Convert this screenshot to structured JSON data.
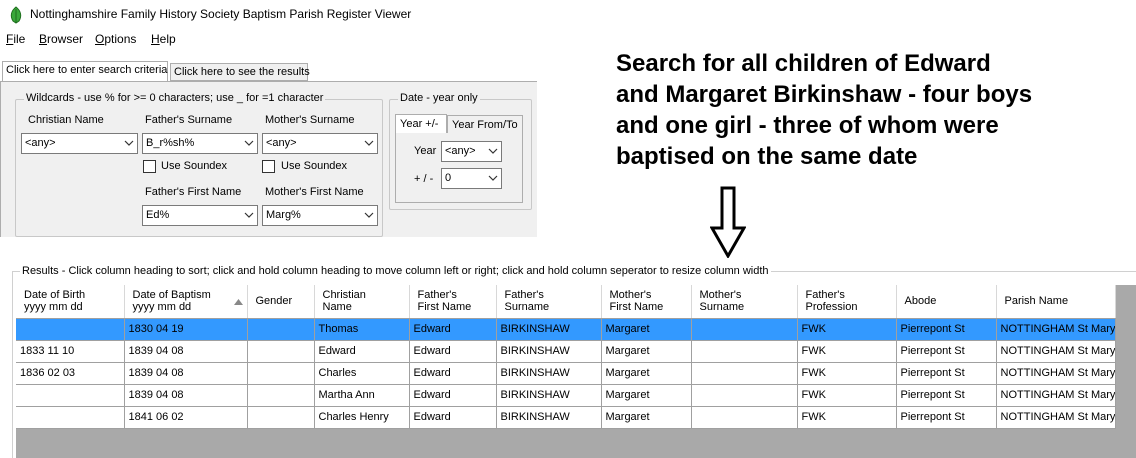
{
  "window": {
    "title": "Nottinghamshire Family History Society Baptism Parish Register Viewer"
  },
  "menu": [
    {
      "accel": "F",
      "rest": "ile"
    },
    {
      "accel": "B",
      "rest": "rowser"
    },
    {
      "accel": "O",
      "rest": "ptions"
    },
    {
      "accel": "H",
      "rest": "elp"
    }
  ],
  "tabs": {
    "search": "Click here to enter search criteria",
    "results": "Click here to see the results"
  },
  "wildcards": {
    "legend": "Wildcards - use  %  for >= 0 characters;  use  _  for =1 character",
    "christian_name": {
      "label": "Christian Name",
      "value": "<any>"
    },
    "fathers_surname": {
      "label": "Father's Surname",
      "value": "B_r%sh%"
    },
    "mothers_surname": {
      "label": "Mother's Surname",
      "value": "<any>"
    },
    "soundex_label": "Use Soundex",
    "fathers_first_name": {
      "label": "Father's First Name",
      "value": "Ed%"
    },
    "mothers_first_name": {
      "label": "Mother's First Name",
      "value": "Marg%"
    }
  },
  "date": {
    "legend": "Date - year only",
    "tab_year": "Year +/-",
    "tab_from_to": "Year From/To",
    "year_label": "Year",
    "year_value": "<any>",
    "plusminus_label": "+ / -",
    "plusminus_value": "0"
  },
  "annotation": {
    "line1": "Search for all children of Edward",
    "line2": "and Margaret Birkinshaw - four boys",
    "line3": "and one girl - three of whom were",
    "line4": "baptised on the same date"
  },
  "results": {
    "legend": "Results - Click column heading to sort; click and hold column heading to move column left or right; click and hold column seperator to resize column width",
    "columns": [
      [
        "Date of Birth",
        "yyyy mm dd"
      ],
      [
        "Date of Baptism",
        "yyyy mm dd"
      ],
      [
        "Gender",
        ""
      ],
      [
        "Christian",
        "Name"
      ],
      [
        "Father's",
        "First Name"
      ],
      [
        "Father's",
        "Surname"
      ],
      [
        "Mother's",
        "First Name"
      ],
      [
        "Mother's",
        "Surname"
      ],
      [
        "Father's",
        "Profession"
      ],
      [
        "Abode",
        ""
      ],
      [
        "Parish Name",
        ""
      ]
    ],
    "rows": [
      [
        "",
        "1830 04 19",
        "",
        "Thomas",
        "Edward",
        "BIRKINSHAW",
        "Margaret",
        "",
        "FWK",
        "Pierrepont St",
        "NOTTINGHAM St Mary"
      ],
      [
        "1833 11 10",
        "1839 04 08",
        "",
        "Edward",
        "Edward",
        "BIRKINSHAW",
        "Margaret",
        "",
        "FWK",
        "Pierrepont St",
        "NOTTINGHAM St Mary"
      ],
      [
        "1836 02 03",
        "1839 04 08",
        "",
        "Charles",
        "Edward",
        "BIRKINSHAW",
        "Margaret",
        "",
        "FWK",
        "Pierrepont St",
        "NOTTINGHAM St Mary"
      ],
      [
        "",
        "1839 04 08",
        "",
        "Martha Ann",
        "Edward",
        "BIRKINSHAW",
        "Margaret",
        "",
        "FWK",
        "Pierrepont St",
        "NOTTINGHAM St Mary"
      ],
      [
        "",
        "1841 06 02",
        "",
        "Charles Henry",
        "Edward",
        "BIRKINSHAW",
        "Margaret",
        "",
        "FWK",
        "Pierrepont St",
        "NOTTINGHAM St Mary"
      ]
    ],
    "selected_row": 0
  },
  "colors": {
    "selection": "#3399ff",
    "panel": "#f0f0f0",
    "grid_empty": "#a9a9a9"
  }
}
